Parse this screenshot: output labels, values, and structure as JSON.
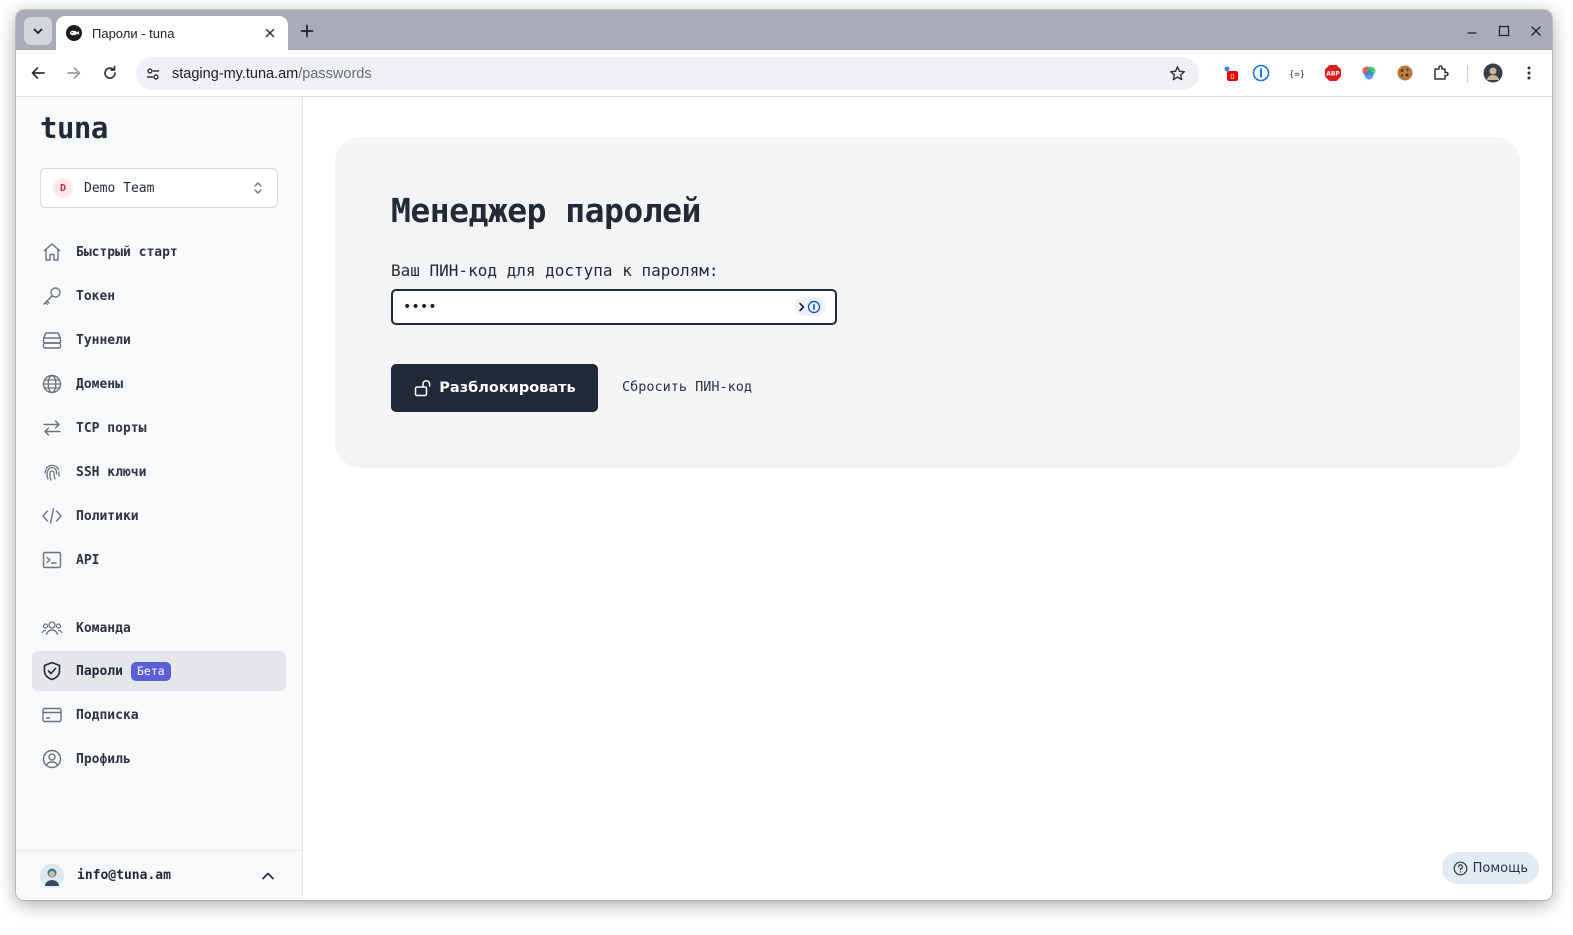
{
  "browser": {
    "tab_title": "Пароли - tuna",
    "url_host": "staging-my.tuna.am",
    "url_path": "/passwords"
  },
  "sidebar": {
    "logo": "tuna",
    "team": {
      "avatar_letter": "D",
      "name": "Demo Team"
    },
    "items": [
      {
        "label": "Быстрый старт",
        "icon": "home-icon"
      },
      {
        "label": "Токен",
        "icon": "key-icon"
      },
      {
        "label": "Туннели",
        "icon": "server-icon"
      },
      {
        "label": "Домены",
        "icon": "globe-icon"
      },
      {
        "label": "TCP порты",
        "icon": "arrows-icon"
      },
      {
        "label": "SSH ключи",
        "icon": "fingerprint-icon"
      },
      {
        "label": "Политики",
        "icon": "code-icon"
      },
      {
        "label": "API",
        "icon": "terminal-icon"
      },
      {
        "label": "Команда",
        "icon": "users-icon"
      },
      {
        "label": "Пароли",
        "icon": "shield-icon",
        "badge": "Бета",
        "active": true
      },
      {
        "label": "Подписка",
        "icon": "credit-card-icon"
      },
      {
        "label": "Профиль",
        "icon": "user-circle-icon"
      }
    ],
    "user_email": "info@tuna.am"
  },
  "main": {
    "title": "Менеджер паролей",
    "pin_label": "Ваш ПИН-код для доступа к паролям:",
    "pin_value": "••••",
    "unlock_button": "Разблокировать",
    "reset_link": "Сбросить ПИН-код",
    "help_button": "Помощь"
  },
  "colors": {
    "primary_button": "#1f2937",
    "badge": "#5b5fd6",
    "card_background": "#f3f4f6",
    "tab_strip": "#a9acb8"
  }
}
